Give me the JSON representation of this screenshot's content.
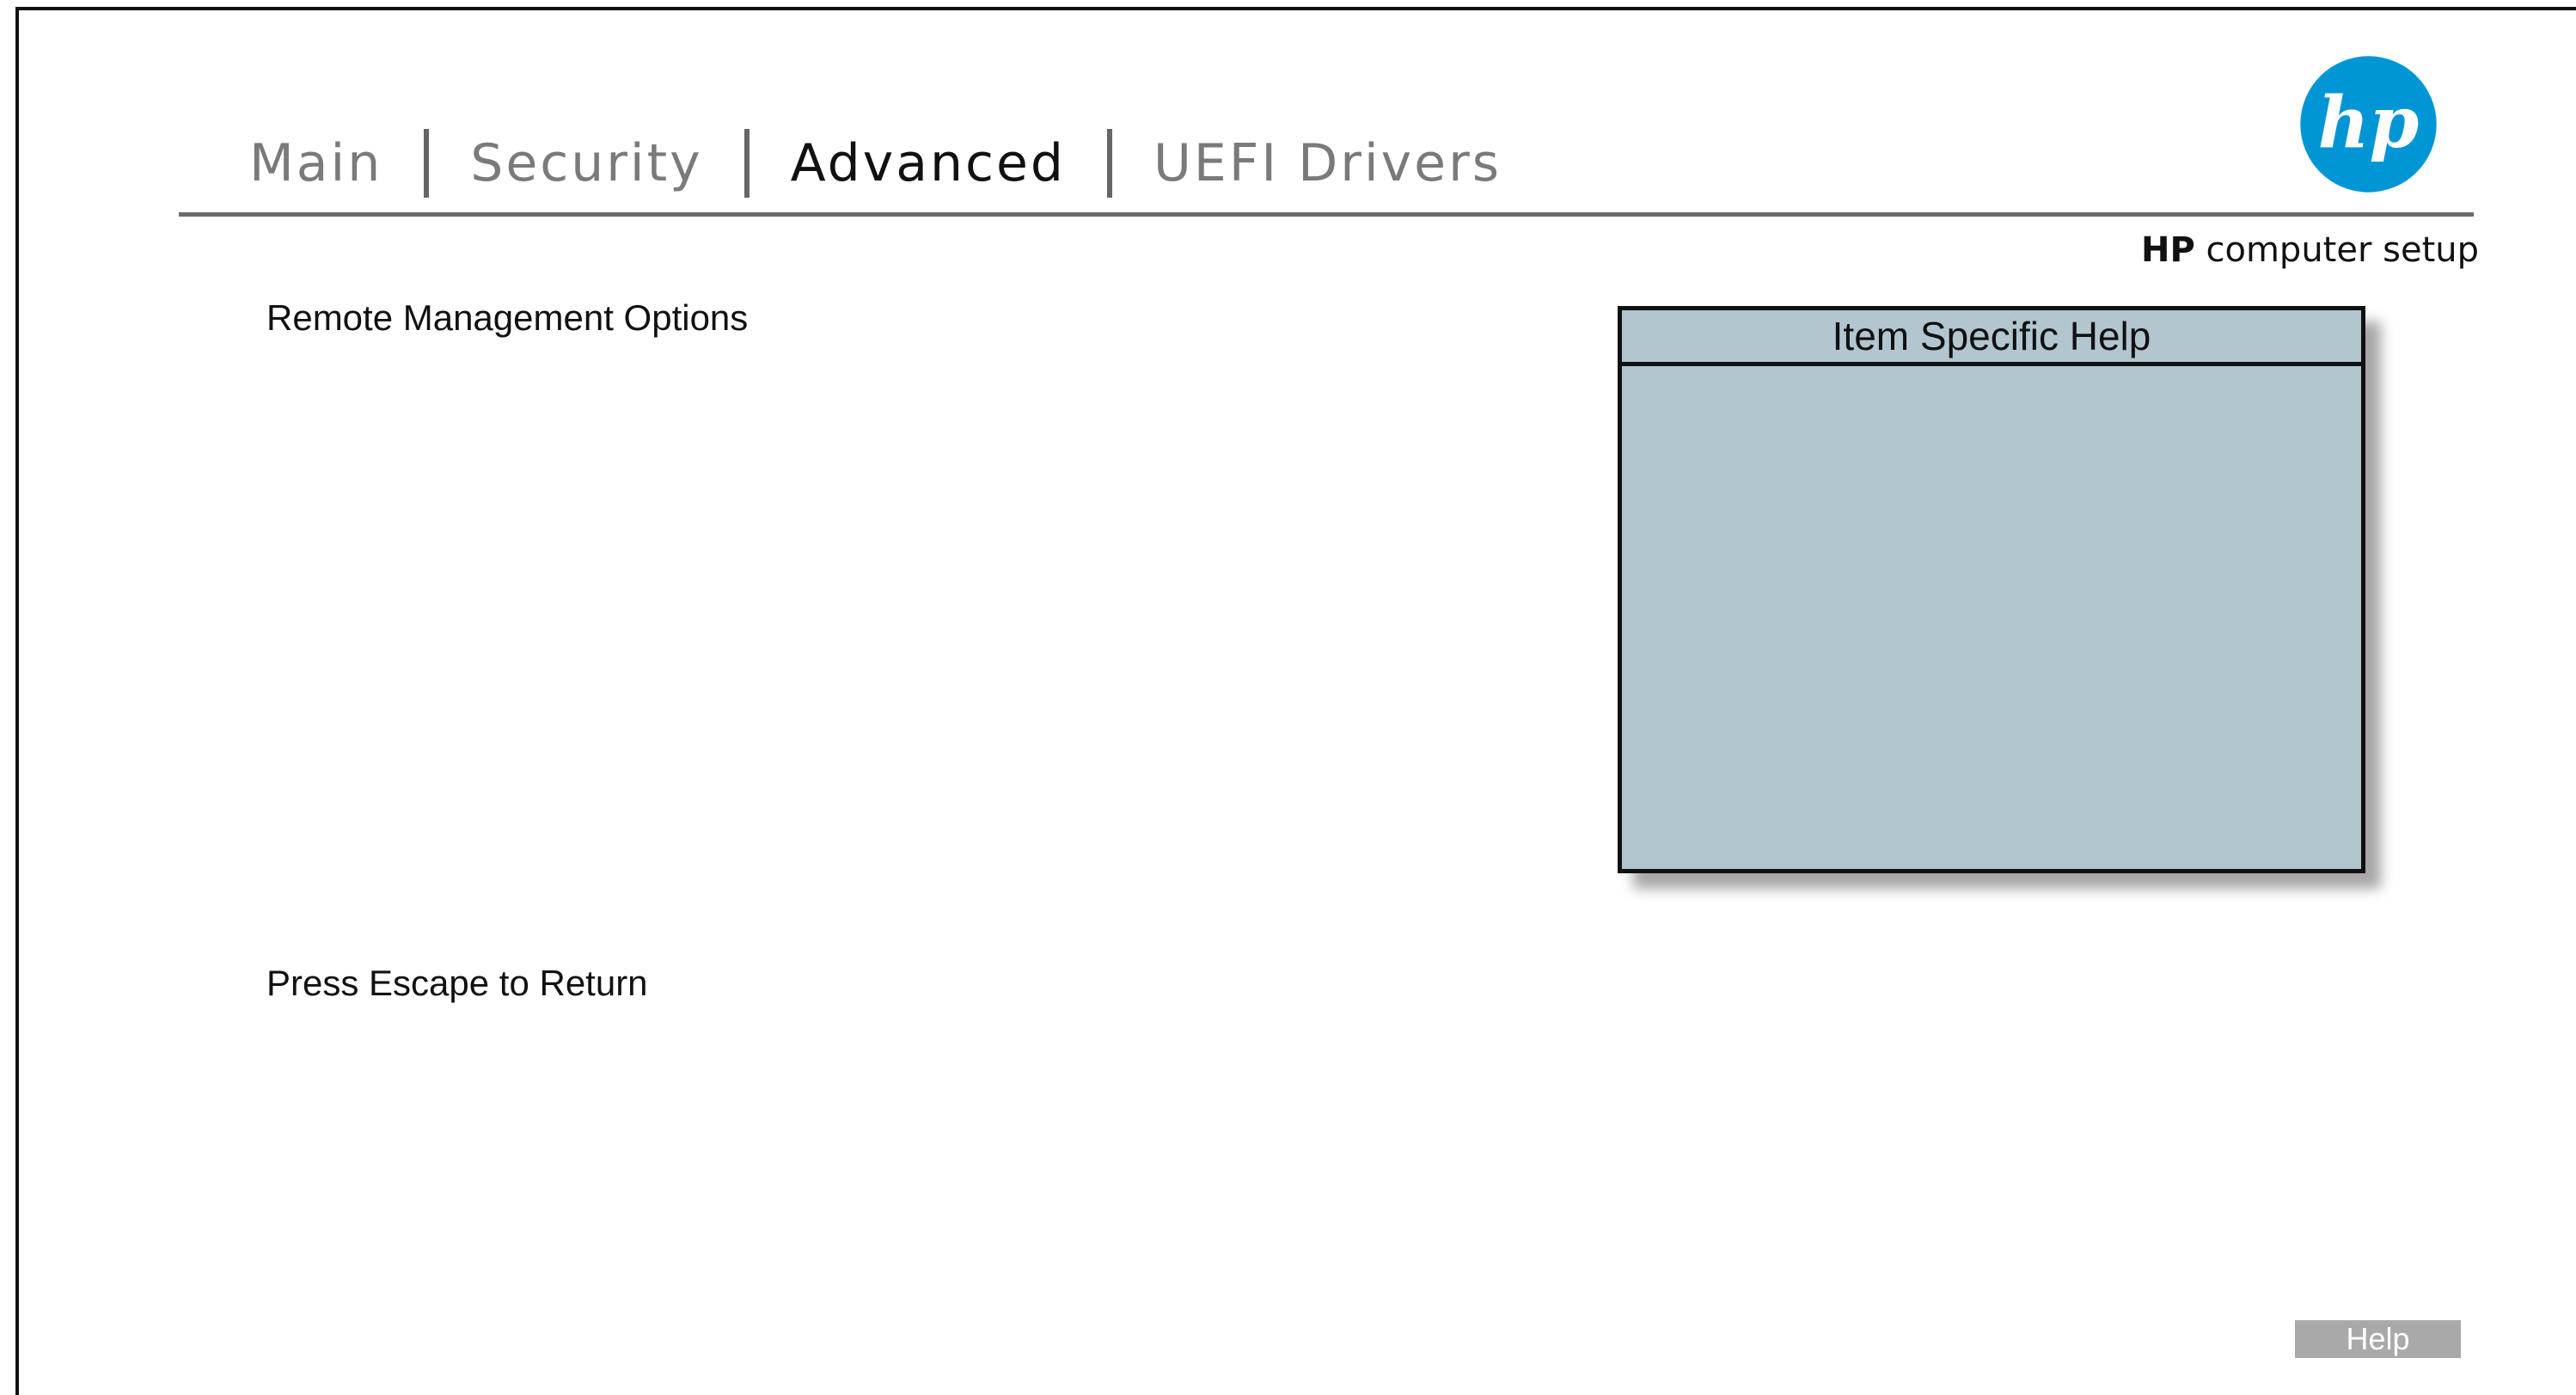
{
  "tabs": [
    {
      "label": "Main",
      "active": false
    },
    {
      "label": "Security",
      "active": false
    },
    {
      "label": "Advanced",
      "active": true
    },
    {
      "label": "UEFI Drivers",
      "active": false
    }
  ],
  "logo": {
    "icon": "hp-logo",
    "text": "hp",
    "color": "#0096d6"
  },
  "brand": {
    "bold": "HP",
    "rest": " computer setup"
  },
  "menu": {
    "items": [
      {
        "label": "Remote Management Options"
      }
    ]
  },
  "footer": {
    "hint": "Press Escape to Return"
  },
  "help_panel": {
    "title": "Item Specific Help",
    "body": ""
  },
  "help_button": {
    "label": "Help"
  },
  "colors": {
    "panel_bg": "#b2c6d0",
    "active_tab": "#111111",
    "inactive_tab": "#7a7a7a",
    "accent": "#0096d6"
  }
}
